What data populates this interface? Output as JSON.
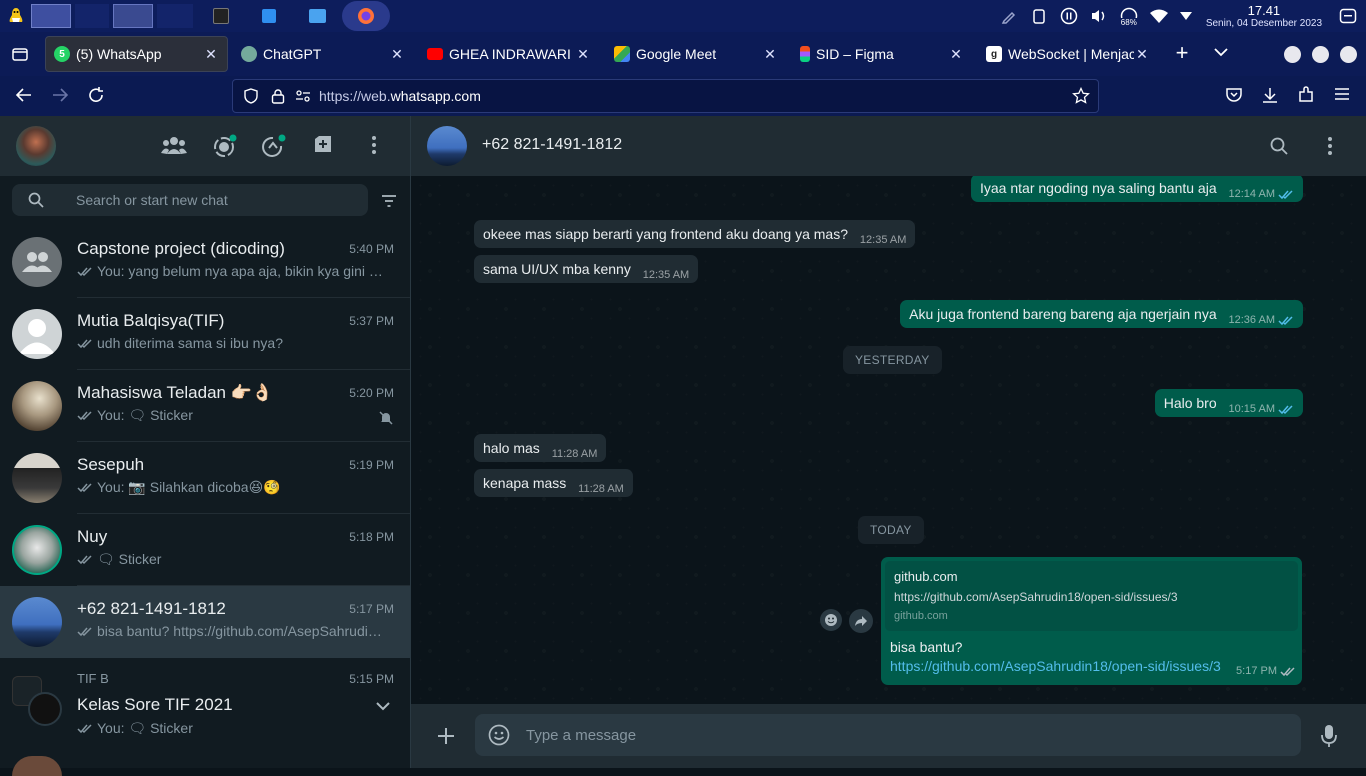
{
  "taskbar": {
    "clock_time": "17.41",
    "clock_date": "Senin, 04 Desember 2023",
    "battery": "68%"
  },
  "tabs": [
    {
      "label": "(5) WhatsApp",
      "favicon": "whatsapp-favicon",
      "color": "#25d366",
      "active": true
    },
    {
      "label": "ChatGPT",
      "favicon": "chatgpt-favicon",
      "color": "#74aa9c"
    },
    {
      "label": "GHEA INDRAWARI - J",
      "favicon": "youtube-favicon",
      "color": "#ff0000"
    },
    {
      "label": "Google Meet",
      "favicon": "google-meet-favicon",
      "color": "#00897b"
    },
    {
      "label": "SID – Figma",
      "favicon": "figma-favicon",
      "color": "#1e1e1e"
    },
    {
      "label": "WebSocket | Menjac",
      "favicon": "websocket-favicon",
      "color": "#3a3a3a"
    }
  ],
  "browser": {
    "url_prefix": "https://web.",
    "url_host": "whatsapp.com"
  },
  "sidebar": {
    "search_placeholder": "Search or start new chat",
    "chats": [
      {
        "name": "Capstone project (dicoding)",
        "time": "5:40 PM",
        "preview": "You: yang belum nya apa aja, bikin kya gini pu…",
        "avatar": "group-avatar"
      },
      {
        "name": "Mutia Balqisya(TIF)",
        "time": "5:37 PM",
        "preview": "udh diterima sama si ibu nya?",
        "avatar": "default-avatar"
      },
      {
        "name": "Mahasiswa Teladan 👉🏻👌🏻",
        "time": "5:20 PM",
        "preview": "You: 🗨 Sticker",
        "avatar": "photo-avatar",
        "muted": true
      },
      {
        "name": "Sesepuh",
        "time": "5:19 PM",
        "preview": "You: 📷 Silahkan dicoba😆🧐",
        "avatar": "photo-avatar"
      },
      {
        "name": "Nuy",
        "time": "5:18 PM",
        "preview": "🗨 Sticker",
        "avatar": "photo-avatar"
      },
      {
        "name": "+62 821-1491-1812",
        "time": "5:17 PM",
        "preview": "bisa bantu? https://github.com/AsepSahrudi…",
        "avatar": "photo-avatar",
        "active": true
      },
      {
        "community": "TIF B",
        "name": "Kelas Sore TIF 2021",
        "time": "5:15 PM",
        "preview": "You: 🗨 Sticker",
        "avatar": "community-avatar"
      }
    ]
  },
  "conversation": {
    "contact": "+62 821-1491-1812",
    "composer_placeholder": "Type a message",
    "messages": [
      {
        "dir": "out",
        "text": "Iyaa ntar ngoding nya saling bantu aja",
        "time": "12:14 AM"
      },
      {
        "dir": "in",
        "text": "okeee mas siapp berarti yang frontend aku doang ya mas?",
        "time": "12:35 AM"
      },
      {
        "dir": "in",
        "text": "sama UI/UX mba kenny",
        "time": "12:35 AM"
      },
      {
        "dir": "out",
        "text": "Aku juga frontend bareng bareng aja ngerjain nya",
        "time": "12:36 AM"
      },
      {
        "dir": "out",
        "text": "Halo bro",
        "time": "10:15 AM"
      },
      {
        "dir": "in",
        "text": "halo mas",
        "time": "11:28 AM"
      },
      {
        "dir": "in",
        "text": "kenapa mass",
        "time": "11:28 AM"
      }
    ],
    "day_yesterday": "YESTERDAY",
    "day_today": "TODAY",
    "link_message": {
      "preview_title": "github.com",
      "preview_url": "https://github.com/AsepSahrudin18/open-sid/issues/3",
      "preview_domain": "github.com",
      "text": "bisa bantu?",
      "link": "https://github.com/AsepSahrudin18/open-sid/issues/3",
      "time": "5:17 PM"
    }
  },
  "colors": {
    "panel": "#202c33",
    "bubble_out": "#005c4b",
    "bubble_in": "#202c33",
    "accent": "#00a884",
    "read_ticks": "#53bdeb"
  }
}
